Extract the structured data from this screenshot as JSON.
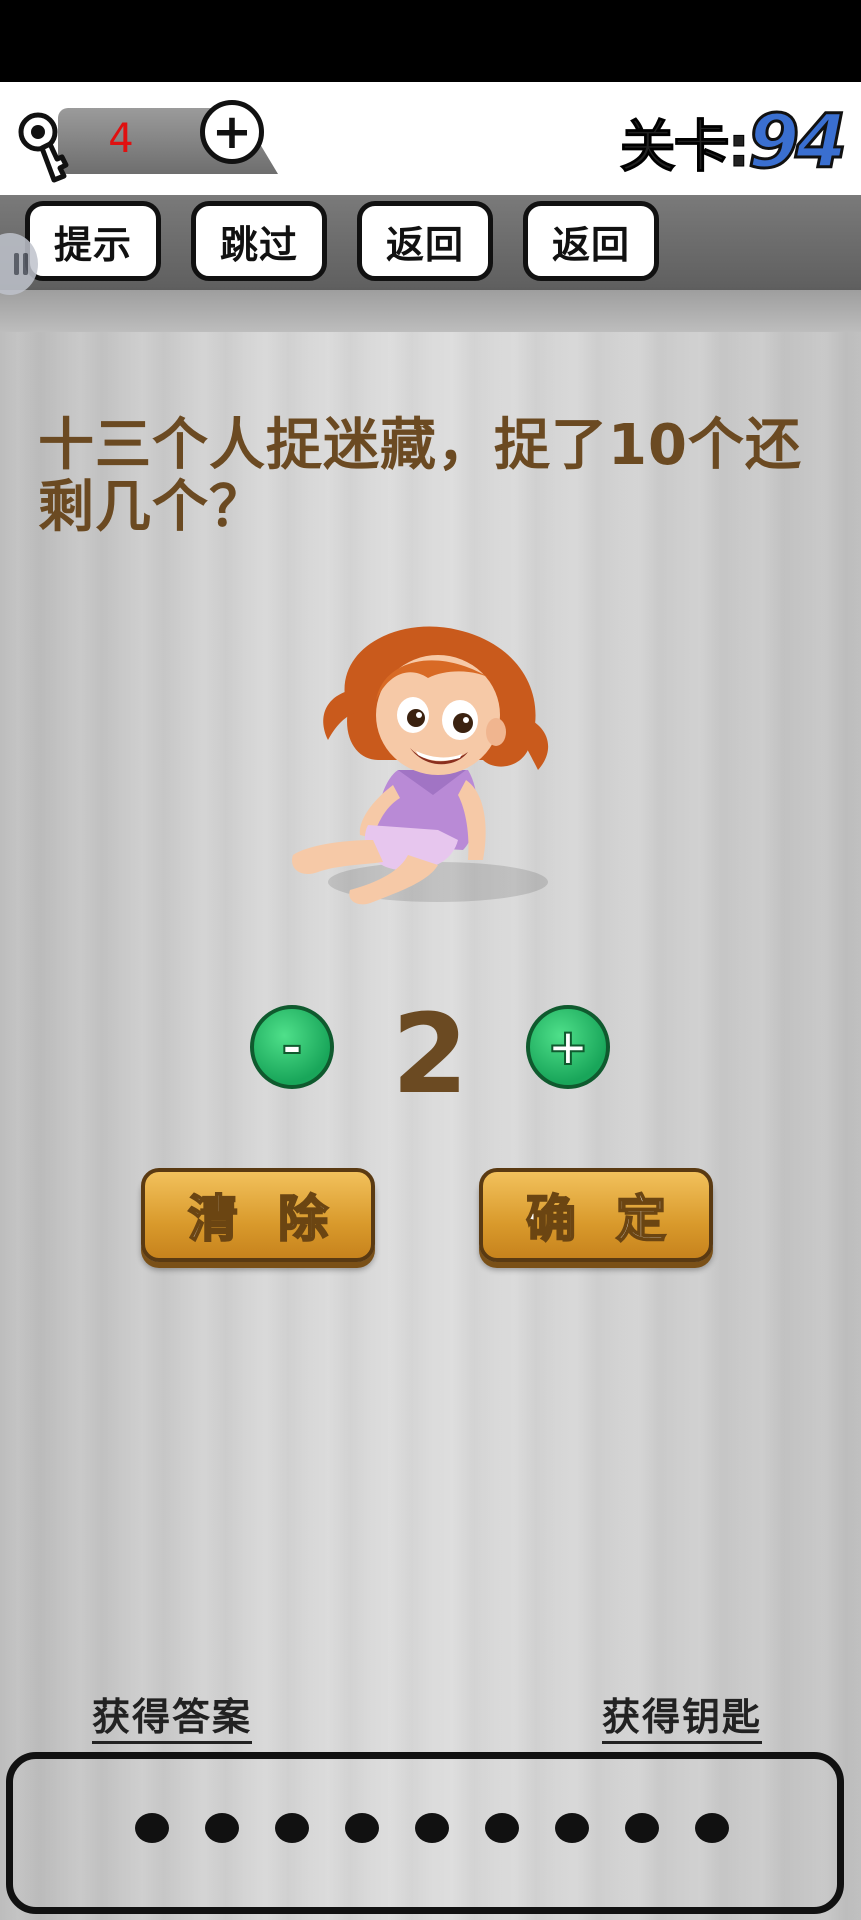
{
  "header": {
    "key_count": "4",
    "add_key_symbol": "+",
    "level_label": "关卡:",
    "level_number": "94"
  },
  "toolbar": {
    "hint_label": "提示",
    "skip_label": "跳过",
    "back_label_1": "返回",
    "back_label_2": "返回"
  },
  "question": {
    "text": "十三个人捉迷藏，捉了10个还剩几个？"
  },
  "answer": {
    "minus_symbol": "-",
    "value": "2",
    "plus_symbol": "+"
  },
  "actions": {
    "clear_label": "清除",
    "confirm_label": "确定"
  },
  "footer": {
    "get_answer_label": "获得答案",
    "get_keys_label": "获得钥匙",
    "slot_count": 9
  },
  "colors": {
    "question_text": "#6b4a22",
    "level_number": "#3a6fd0",
    "key_count": "#e01010",
    "stepper_green": "#19a65a",
    "button_gold": "#d99a2c"
  }
}
